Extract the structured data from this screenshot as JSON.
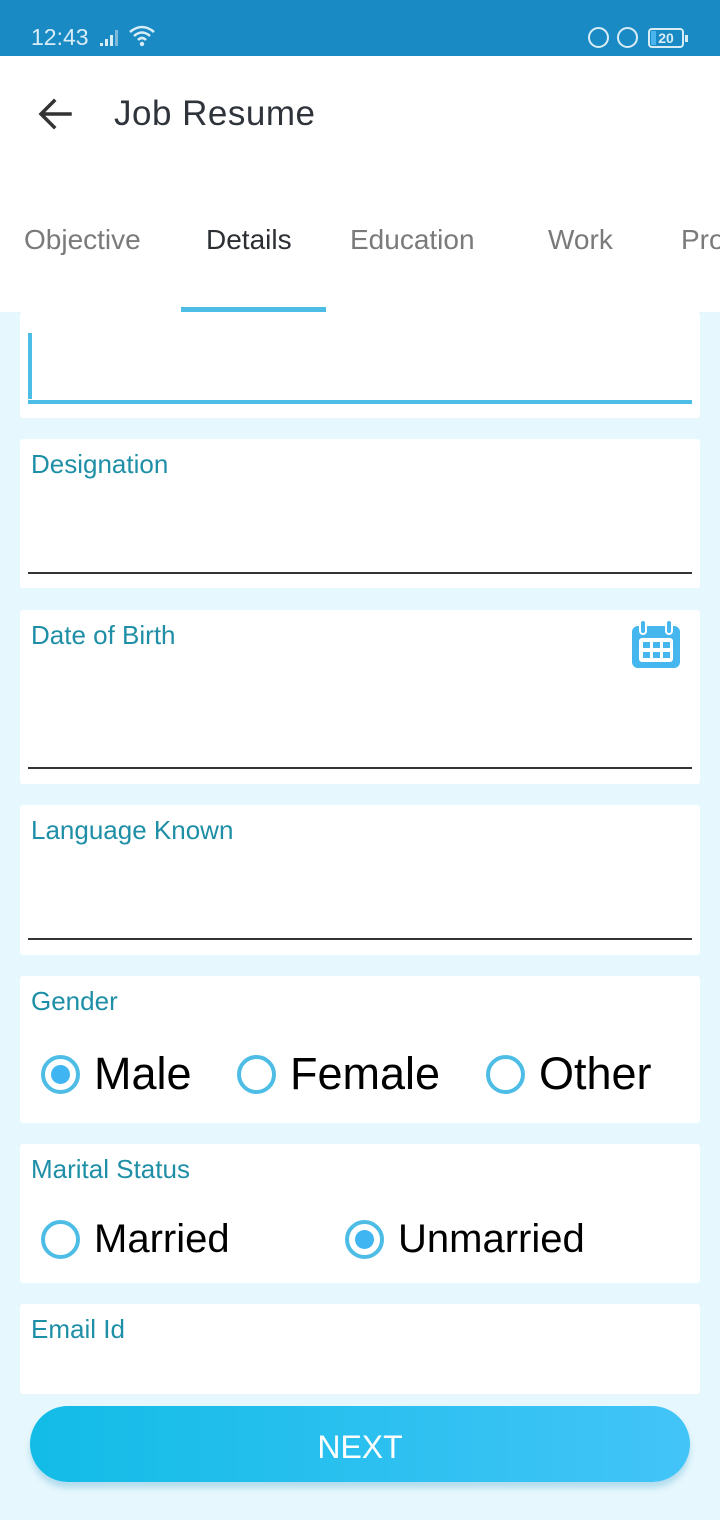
{
  "status_bar": {
    "time": "12:43",
    "battery": "20",
    "icons": [
      "signal-icon",
      "wifi-icon",
      "data-saver-icon",
      "rotation-lock-icon",
      "battery-icon"
    ]
  },
  "app_bar": {
    "title": "Job Resume",
    "back_icon": "arrow-left-icon"
  },
  "tabs": [
    {
      "label": "Objective",
      "active": false
    },
    {
      "label": "Details",
      "active": true
    },
    {
      "label": "Education",
      "active": false
    },
    {
      "label": "Work",
      "active": false
    },
    {
      "label": "Projects",
      "visible_text": "Pro",
      "active": false
    }
  ],
  "form": {
    "focused_field": {
      "value": "",
      "placeholder": ""
    },
    "designation": {
      "label": "Designation",
      "value": ""
    },
    "date_of_birth": {
      "label": "Date of Birth",
      "value": "",
      "icon": "calendar-icon"
    },
    "language_known": {
      "label": "Language Known",
      "value": ""
    },
    "gender": {
      "label": "Gender",
      "options": [
        "Male",
        "Female",
        "Other"
      ],
      "selected": "Male"
    },
    "marital_status": {
      "label": "Marital Status",
      "options": [
        "Married",
        "Unmarried"
      ],
      "selected": "Unmarried"
    },
    "email": {
      "label": "Email Id",
      "value": ""
    }
  },
  "actions": {
    "next_label": "NEXT"
  },
  "colors": {
    "status_bar": "#1a8ac4",
    "accent": "#4dbde6",
    "label": "#1e8fa6",
    "background": "#e6f7fd"
  }
}
